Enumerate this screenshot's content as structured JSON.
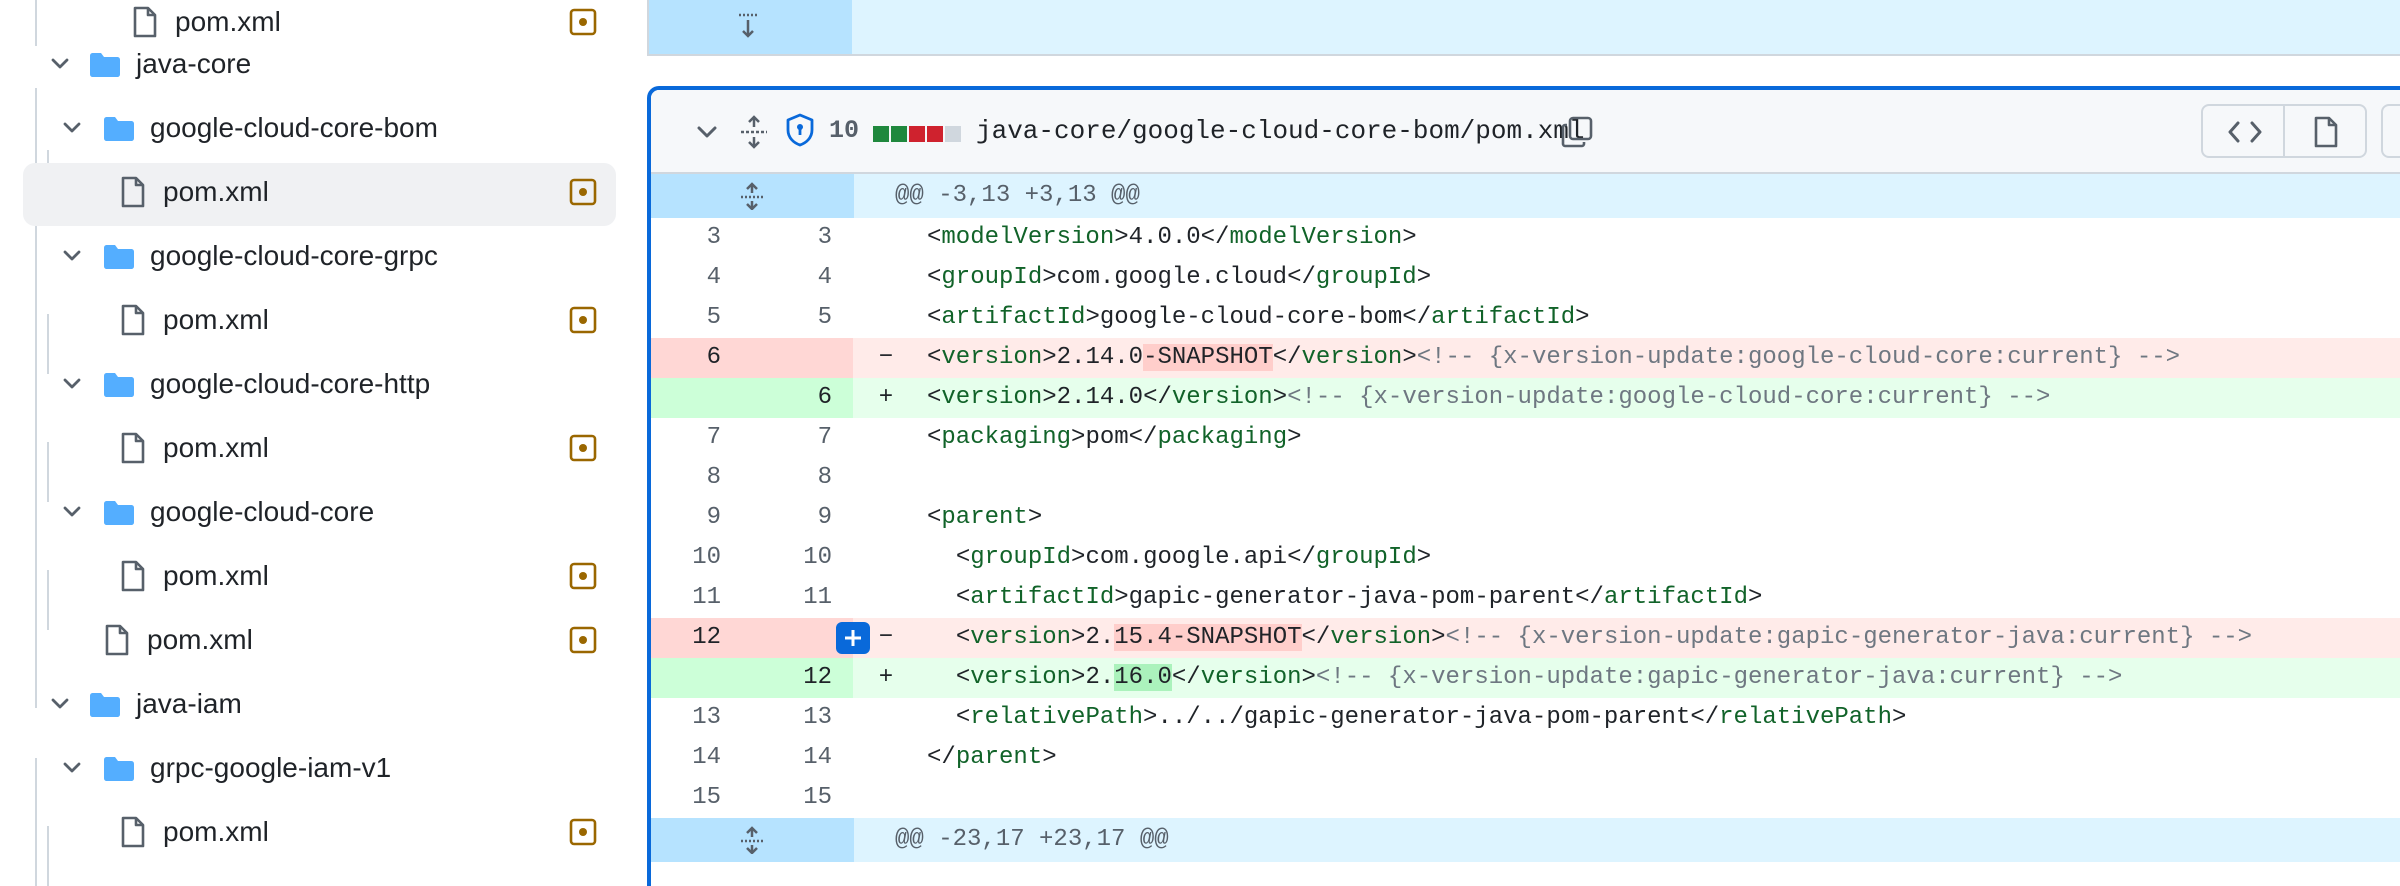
{
  "file_tree": {
    "items": [
      {
        "label": "pom.xml",
        "kind": "file"
      },
      {
        "label": "java-core",
        "kind": "folder"
      },
      {
        "label": "google-cloud-core-bom",
        "kind": "folder"
      },
      {
        "label": "pom.xml",
        "kind": "file",
        "selected": true
      },
      {
        "label": "google-cloud-core-grpc",
        "kind": "folder"
      },
      {
        "label": "pom.xml",
        "kind": "file"
      },
      {
        "label": "google-cloud-core-http",
        "kind": "folder"
      },
      {
        "label": "pom.xml",
        "kind": "file"
      },
      {
        "label": "google-cloud-core",
        "kind": "folder"
      },
      {
        "label": "pom.xml",
        "kind": "file"
      },
      {
        "label": "pom.xml",
        "kind": "file"
      },
      {
        "label": "java-iam",
        "kind": "folder"
      },
      {
        "label": "grpc-google-iam-v1",
        "kind": "folder"
      },
      {
        "label": "pom.xml",
        "kind": "file"
      }
    ],
    "icons": {
      "folder": "folder-icon",
      "file": "file-icon",
      "chevron": "chevron-down-icon",
      "status": "file-modified-icon"
    }
  },
  "file_header": {
    "change_count": "10",
    "diffstat": [
      "added",
      "added",
      "removed",
      "removed",
      "neutral"
    ],
    "path": "java-core/google-cloud-core-bom/pom.xml",
    "icons": [
      "chevron-down-icon",
      "unfold-icon",
      "shield-check-icon",
      "copy-icon",
      "code-icon",
      "file-icon"
    ]
  },
  "diff": {
    "hunks": [
      {
        "header": "@@ -3,13 +3,13 @@"
      },
      {
        "header": "@@ -23,17 +23,17 @@"
      }
    ],
    "lines": [
      {
        "old": "3",
        "new": "3",
        "type": "ctx",
        "indent": "",
        "tag": "modelVersion",
        "value": "4.0.0"
      },
      {
        "old": "4",
        "new": "4",
        "type": "ctx",
        "indent": "",
        "tag": "groupId",
        "value": "com.google.cloud"
      },
      {
        "old": "5",
        "new": "5",
        "type": "ctx",
        "indent": "",
        "tag": "artifactId",
        "value": "google-cloud-core-bom"
      },
      {
        "old": "6",
        "new": "",
        "type": "del",
        "marker": "−",
        "indent": "",
        "tag": "version",
        "pre": "2.14.0",
        "hl": "-SNAPSHOT",
        "post": "",
        "comment": "<!-- {x-version-update:google-cloud-core:current} -->"
      },
      {
        "old": "",
        "new": "6",
        "type": "add",
        "marker": "+",
        "indent": "",
        "tag": "version",
        "pre": "2.14.0",
        "hl": "",
        "post": "",
        "comment": "<!-- {x-version-update:google-cloud-core:current} -->"
      },
      {
        "old": "7",
        "new": "7",
        "type": "ctx",
        "indent": "",
        "tag": "packaging",
        "value": "pom"
      },
      {
        "old": "8",
        "new": "8",
        "type": "ctx",
        "indent": "",
        "raw": ""
      },
      {
        "old": "9",
        "new": "9",
        "type": "ctx",
        "indent": "",
        "open": "parent"
      },
      {
        "old": "10",
        "new": "10",
        "type": "ctx",
        "indent": "  ",
        "tag": "groupId",
        "value": "com.google.api"
      },
      {
        "old": "11",
        "new": "11",
        "type": "ctx",
        "indent": "  ",
        "tag": "artifactId",
        "value": "gapic-generator-java-pom-parent"
      },
      {
        "old": "12",
        "new": "",
        "type": "del",
        "marker": "−",
        "indent": "  ",
        "tag": "version",
        "pre": "2.",
        "hl": "15.4-SNAPSHOT",
        "post": "",
        "comment": "<!-- {x-version-update:gapic-generator-java:current} -->",
        "add_button": "+"
      },
      {
        "old": "",
        "new": "12",
        "type": "add",
        "marker": "+",
        "indent": "  ",
        "tag": "version",
        "pre": "2.",
        "hl": "16.0",
        "post": "",
        "comment": "<!-- {x-version-update:gapic-generator-java:current} -->"
      },
      {
        "old": "13",
        "new": "13",
        "type": "ctx",
        "indent": "  ",
        "tag": "relativePath",
        "value": "../../gapic-generator-java-pom-parent"
      },
      {
        "old": "14",
        "new": "14",
        "type": "ctx",
        "indent": "",
        "close": "parent"
      },
      {
        "old": "15",
        "new": "15",
        "type": "ctx",
        "indent": "",
        "raw": ""
      }
    ]
  },
  "colors": {
    "accent": "#0969da",
    "folder": "#54aeff",
    "modified": "#9a6700",
    "del_bg": "#ffebe9",
    "add_bg": "#e6ffec",
    "hunk_bg": "#ddf4ff"
  }
}
